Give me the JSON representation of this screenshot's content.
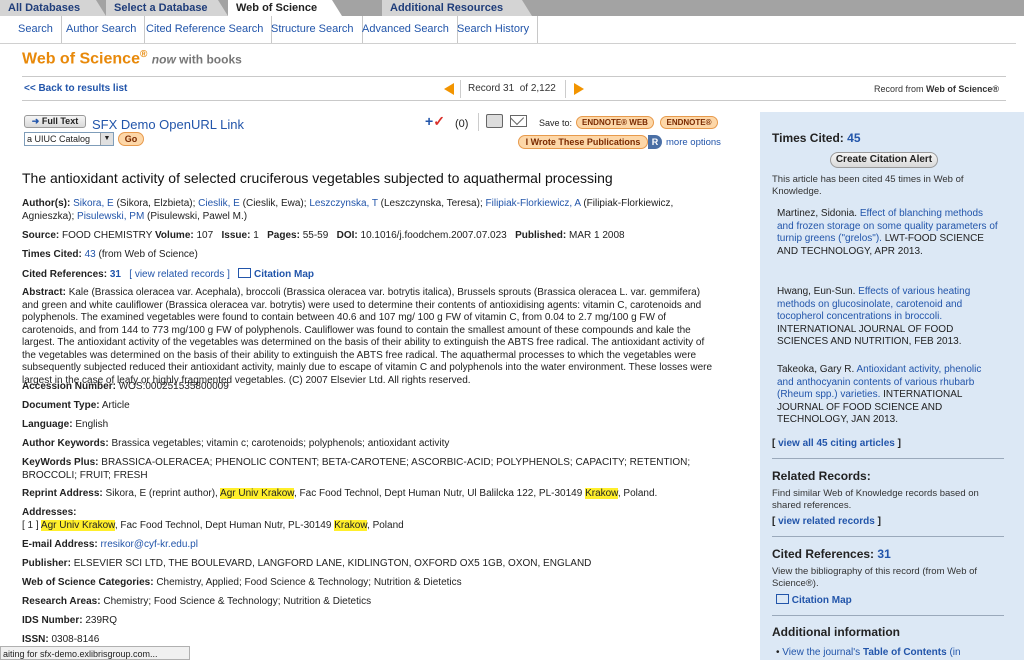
{
  "tabs": [
    {
      "label": "All Databases"
    },
    {
      "label": "Select a Database"
    },
    {
      "label": "Web of Science"
    },
    {
      "label": "Additional Resources"
    }
  ],
  "subnav": [
    "Search",
    "Author Search",
    "Cited Reference Search",
    "Structure Search",
    "Advanced Search",
    "Search History"
  ],
  "brand": {
    "name": "Web of Science",
    "reg": "®",
    "tag_italic": "now",
    "tag_rest": " with books"
  },
  "nav": {
    "back": "<< Back to results list",
    "record_label": "Record",
    "record_num": "31",
    "of_label": "of",
    "record_total": "2,122",
    "record_from": "Record from",
    "record_from_name": "Web of Science®"
  },
  "tools": {
    "full_text": "Full Text",
    "sfx": "SFX Demo OpenURL Link",
    "catalog_value": "a UIUC Catalog",
    "go": "Go",
    "marked_count": "(0)",
    "save_to": "Save to:",
    "endnote_web": "ENDNOTE® WEB",
    "endnote": "ENDNOTE®",
    "wrote": "I Wrote These Publications",
    "wrote_r": "R",
    "more_options": "more options"
  },
  "record": {
    "title": "The antioxidant activity of selected cruciferous vegetables subjected to aquathermal processing",
    "authors_label": "Author(s):",
    "authors": [
      {
        "short": "Sikora, E",
        "full": " (Sikora, Elzbieta); "
      },
      {
        "short": "Cieslik, E",
        "full": " (Cieslik, Ewa); "
      },
      {
        "short": "Leszczynska, T",
        "full": " (Leszczynska, Teresa); "
      },
      {
        "short": "Filipiak-Florkiewicz, A",
        "full": " (Filipiak-Florkiewicz, Agnieszka); "
      },
      {
        "short": "Pisulewski, PM",
        "full": " (Pisulewski, Pawel M.)"
      }
    ],
    "source_label": "Source:",
    "source": "FOOD CHEMISTRY",
    "volume_label": "Volume:",
    "volume": "107",
    "issue_label": "Issue:",
    "issue": "1",
    "pages_label": "Pages:",
    "pages": "55-59",
    "doi_label": "DOI:",
    "doi": "10.1016/j.foodchem.2007.07.023",
    "published_label": "Published:",
    "published": "MAR 1 2008",
    "times_cited_label": "Times Cited:",
    "times_cited": "43",
    "times_cited_from": "(from Web of Science)",
    "cited_refs_label": "Cited References:",
    "cited_refs": "31",
    "view_related": "[ view related records ]",
    "citation_map": "Citation Map",
    "abstract_label": "Abstract:",
    "abstract": "Kale (Brassica oleracea var. Acephala), broccoli (Brassica oleracea var. botrytis italica), Brussels sprouts (Brassica oleracea L. var. gemmifera) and green and white cauliflower (Brassica oleracea var. botrytis) were used to determine their contents of antioxidising agents: vitamin C, carotenoids and polyphenols. The examined vegetables were found to contain between 40.6 and 107 mg/ 100 g FW of vitamin C, from 0.04 to 2.7 mg/100 g FW of carotenoids, and from 144 to 773 mg/100 g FW of polyphenols. Cauliflower was found to contain the smallest amount of these compounds and kale the largest. The antioxidant activity of the vegetables was determined on the basis of their ability to extinguish the ABTS free radical. The antioxidant activity of the vegetables was determined on the basis of their ability to extinguish the ABTS free radical. The aquathermal processes to which the vegetables were subsequently subjected reduced their antioxidant activity, mainly due to escape of vitamin C and polyphenols into the water environment. These losses were largest in the case of leafy or highly fragmented vegetables. (C) 2007 Elsevier Ltd. All rights reserved.",
    "accession_label": "Accession Number:",
    "accession": "WOS:000251535800009",
    "doctype_label": "Document Type:",
    "doctype": "Article",
    "language_label": "Language:",
    "language": "English",
    "author_kw_label": "Author Keywords:",
    "author_kw": "Brassica vegetables; vitamin c; carotenoids; polyphenols; antioxidant activity",
    "kwplus_label": "KeyWords Plus:",
    "kwplus": "BRASSICA-OLERACEA; PHENOLIC CONTENT; BETA-CAROTENE; ASCORBIC-ACID; POLYPHENOLS; CAPACITY; RETENTION; BROCCOLI; FRUIT; FRESH",
    "reprint_label": "Reprint Address:",
    "reprint_pre": "Sikora, E (reprint author), ",
    "reprint_hl1": "Agr Univ Krakow",
    "reprint_mid": ", Fac Food Technol, Dept Human Nutr, Ul Balilcka 122, PL-30149 ",
    "reprint_hl2": "Krakow",
    "reprint_post": ", Poland.",
    "addresses_label": "Addresses:",
    "addr_pre": "[ 1 ] ",
    "addr_hl1": "Agr Univ Krakow",
    "addr_mid": ", Fac Food Technol, Dept Human Nutr, PL-30149 ",
    "addr_hl2": "Krakow",
    "addr_post": ", Poland",
    "email_label": "E-mail Address:",
    "email": "rresikor@cyf-kr.edu.pl",
    "publisher_label": "Publisher:",
    "publisher": "ELSEVIER SCI LTD, THE BOULEVARD, LANGFORD LANE, KIDLINGTON, OXFORD OX5 1GB, OXON, ENGLAND",
    "wos_cat_label": "Web of Science Categories:",
    "wos_cat": "Chemistry, Applied; Food Science & Technology; Nutrition & Dietetics",
    "research_label": "Research Areas:",
    "research": "Chemistry; Food Science & Technology; Nutrition & Dietetics",
    "ids_label": "IDS Number:",
    "ids": "239RQ",
    "issn_label": "ISSN:",
    "issn": "0308-8146"
  },
  "sidebar": {
    "times_cited_label": "Times Cited:",
    "times_cited": "45",
    "alert_button": "Create Citation Alert",
    "cited_note": "This article has been cited 45 times in Web of Knowledge.",
    "citing": [
      {
        "author": "Martinez, Sidonia. ",
        "title": "Effect of blanching methods and frozen storage on some quality parameters of turnip greens (\"grelos\").",
        "source": " LWT-FOOD SCIENCE AND TECHNOLOGY, APR 2013."
      },
      {
        "author": "Hwang, Eun-Sun. ",
        "title": "Effects of various heating methods on glucosinolate, carotenoid and tocopherol concentrations in broccoli.",
        "source": " INTERNATIONAL JOURNAL OF FOOD SCIENCES AND NUTRITION, FEB 2013."
      },
      {
        "author": "Takeoka, Gary R. ",
        "title": "Antioxidant activity, phenolic and anthocyanin contents of various rhubarb (Rheum spp.) varieties.",
        "source": " INTERNATIONAL JOURNAL OF FOOD SCIENCE AND TECHNOLOGY, JAN 2013."
      }
    ],
    "view_all": "view all 45 citing articles",
    "related_title": "Related Records:",
    "related_text": "Find similar Web of Knowledge records based on shared references.",
    "view_related": "view related records",
    "cited_refs_label": "Cited References:",
    "cited_refs": "31",
    "cited_refs_text": "View the bibliography of this record (from Web of Science®).",
    "citation_map": "Citation Map",
    "additional_title": "Additional information",
    "journal_toc_pre": "View the journal's ",
    "journal_toc_bold": "Table of Contents",
    "journal_toc_post": " (in"
  },
  "status": "aiting for sfx-demo.exlibrisgroup.com...",
  "colors": {
    "brand_orange": "#e8890a",
    "link_blue": "#2255aa",
    "sidebar_bg": "#dce8f5",
    "highlight": "#ffef2b"
  }
}
